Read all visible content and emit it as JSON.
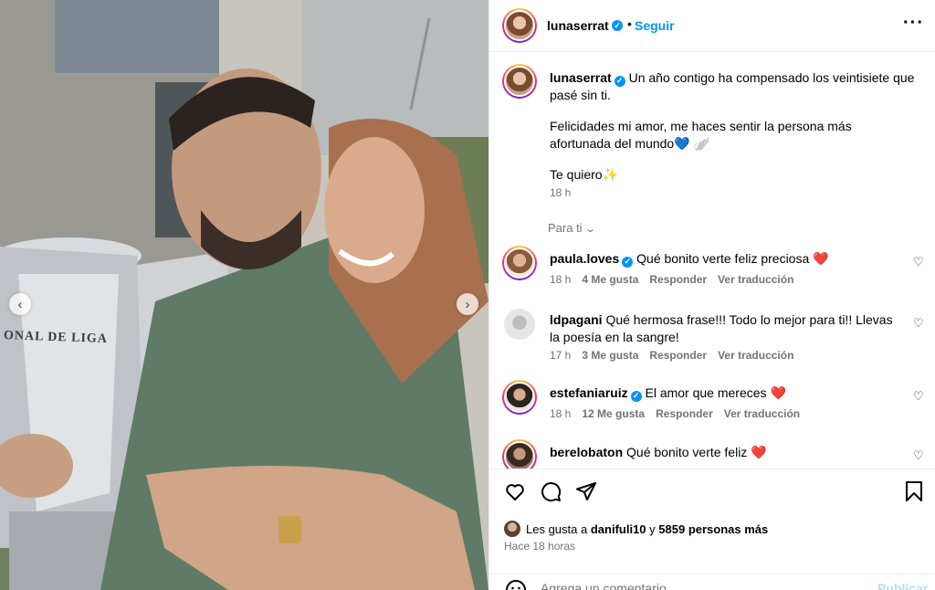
{
  "post": {
    "username": "lunaserrat",
    "follow_label": "Seguir",
    "separator": "•",
    "more_icon": "more-options-icon",
    "photo_text": "ONAL DE LIGA"
  },
  "caption": {
    "username": "lunaserrat",
    "line1": "Un año contigo ha compensado los veintisiete que pasé sin ti.",
    "line2": "Felicidades mi amor, me haces sentir la persona más afortunada del mundo💙 🪽",
    "line3": "Te quiero✨",
    "time": "18 h"
  },
  "for_you_label": "Para ti",
  "comments": [
    {
      "username": "paula.loves",
      "verified": true,
      "text": "Qué bonito verte feliz preciosa",
      "emoji": "❤️",
      "time": "18 h",
      "likes": "4 Me gusta",
      "reply": "Responder",
      "translate": "Ver traducción"
    },
    {
      "username": "ldpagani",
      "verified": false,
      "text": "Qué hermosa frase!!! Todo lo mejor para ti!! Llevas la poesía en la sangre!",
      "emoji": "",
      "time": "17 h",
      "likes": "3 Me gusta",
      "reply": "Responder",
      "translate": "Ver traducción"
    },
    {
      "username": "estefaniaruiz",
      "verified": true,
      "text": "El amor que mereces",
      "emoji": "❤️",
      "time": "18 h",
      "likes": "12 Me gusta",
      "reply": "Responder",
      "translate": "Ver traducción"
    },
    {
      "username": "berelobaton",
      "verified": false,
      "text": "Qué bonito verte feliz",
      "emoji": "❤️",
      "time": "",
      "likes": "",
      "reply": "",
      "translate": ""
    }
  ],
  "actions": {
    "likes_prefix": "Les gusta a",
    "likes_user": "danifuli10",
    "likes_and": "y",
    "likes_rest": "5859 personas más",
    "time_ago": "Hace 18 horas",
    "comment_placeholder": "Agrega un comentario...",
    "publish_label": "Publicar"
  }
}
